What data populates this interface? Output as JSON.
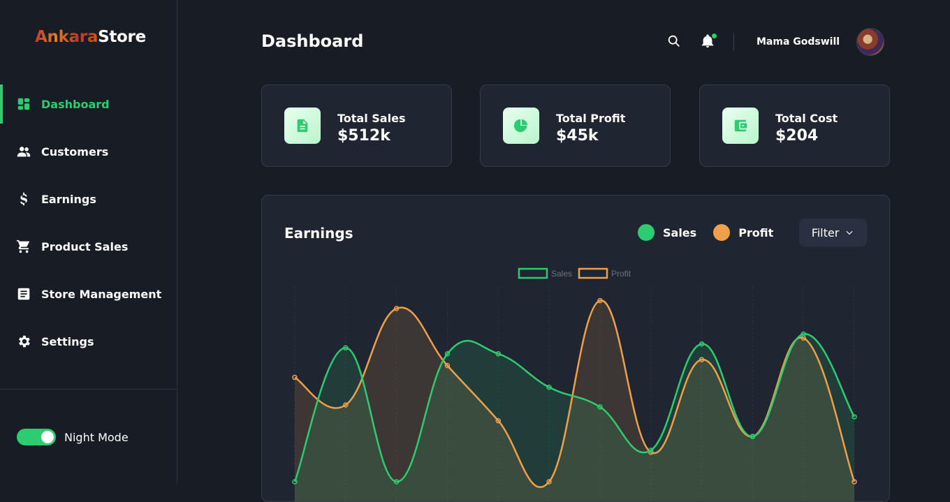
{
  "brand": {
    "part1": "Ankara",
    "part2": "Store"
  },
  "sidebar": {
    "items": [
      {
        "label": "Dashboard",
        "icon": "dashboard-icon",
        "active": true
      },
      {
        "label": "Customers",
        "icon": "people-icon",
        "active": false
      },
      {
        "label": "Earnings",
        "icon": "dollar-icon",
        "active": false
      },
      {
        "label": "Product Sales",
        "icon": "cart-icon",
        "active": false
      },
      {
        "label": "Store Management",
        "icon": "document-icon",
        "active": false
      },
      {
        "label": "Settings",
        "icon": "gear-icon",
        "active": false
      }
    ],
    "night_mode_label": "Night Mode",
    "night_mode_on": true
  },
  "header": {
    "title": "Dashboard",
    "user_name": "Mama Godswill"
  },
  "stats": [
    {
      "label": "Total Sales",
      "value": "$512k",
      "icon": "document-icon"
    },
    {
      "label": "Total Profit",
      "value": "$45k",
      "icon": "pie-chart-icon"
    },
    {
      "label": "Total Cost",
      "value": "$204",
      "icon": "wallet-icon"
    }
  ],
  "earnings": {
    "title": "Earnings",
    "legend": [
      {
        "label": "Sales",
        "color": "#2ecc71"
      },
      {
        "label": "Profit",
        "color": "#f0a04b"
      }
    ],
    "filter_label": "Filter"
  },
  "chart_data": {
    "type": "area",
    "legend": [
      "Sales",
      "Profit"
    ],
    "series": [
      {
        "name": "Sales",
        "color": "#2ecc71",
        "values": [
          0,
          68,
          0,
          65,
          65,
          48,
          38,
          16,
          70,
          23,
          75,
          33
        ]
      },
      {
        "name": "Profit",
        "color": "#f0a04b",
        "values": [
          53,
          39,
          88,
          59,
          31,
          0,
          92,
          15,
          62,
          23,
          73,
          0
        ]
      }
    ],
    "grid": "vertical-dashed"
  },
  "colors": {
    "accent": "#2ecc71",
    "profit": "#f0a04b",
    "background": "#171c25",
    "card": "#1f2631"
  }
}
